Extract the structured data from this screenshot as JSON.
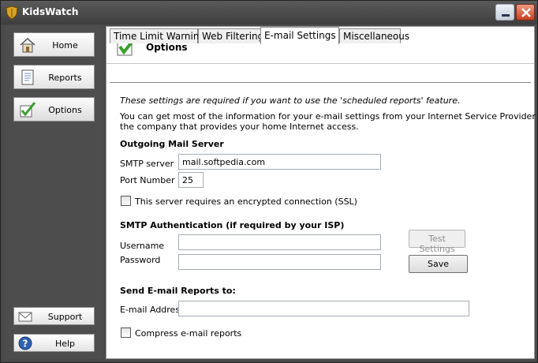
{
  "window": {
    "title": "KidsWatch"
  },
  "sidebar": {
    "items": [
      {
        "label": "Home",
        "icon": "home-icon"
      },
      {
        "label": "Reports",
        "icon": "document-icon"
      },
      {
        "label": "Options",
        "icon": "checkmark-icon",
        "active": true
      }
    ],
    "bottom": [
      {
        "label": "Support",
        "icon": "envelope-icon"
      },
      {
        "label": "Help",
        "icon": "help-icon"
      }
    ]
  },
  "header": {
    "title": "Options"
  },
  "tabs": [
    {
      "label": "Time Limit Warning"
    },
    {
      "label": "Web Filtering"
    },
    {
      "label": "E-mail Settings",
      "active": true
    },
    {
      "label": "Miscellaneous"
    }
  ],
  "email": {
    "intro_italic": "These settings are required if you want to use the 'scheduled reports' feature.",
    "intro_line1": "You can get most of the information for your e-mail settings from your Internet Service Provider (ISP),",
    "intro_line2": "the company that provides your home Internet access.",
    "outgoing_heading": "Outgoing Mail Server",
    "smtp_label": "SMTP server",
    "smtp_value": "mail.softpedia.com",
    "port_label": "Port Number",
    "port_value": "25",
    "ssl_label": "This server requires an encrypted connection (SSL)",
    "auth_heading": "SMTP Authentication (if required by your ISP)",
    "username_label": "Username",
    "username_value": "",
    "password_label": "Password",
    "password_value": "",
    "test_button": "Test Settings",
    "save_button": "Save",
    "send_heading": "Send E-mail Reports to:",
    "address_label": "E-mail Address",
    "address_value": "",
    "compress_label": "Compress e-mail reports"
  },
  "colors": {
    "accent_check": "#3aa030",
    "close_button": "#c8401d"
  }
}
